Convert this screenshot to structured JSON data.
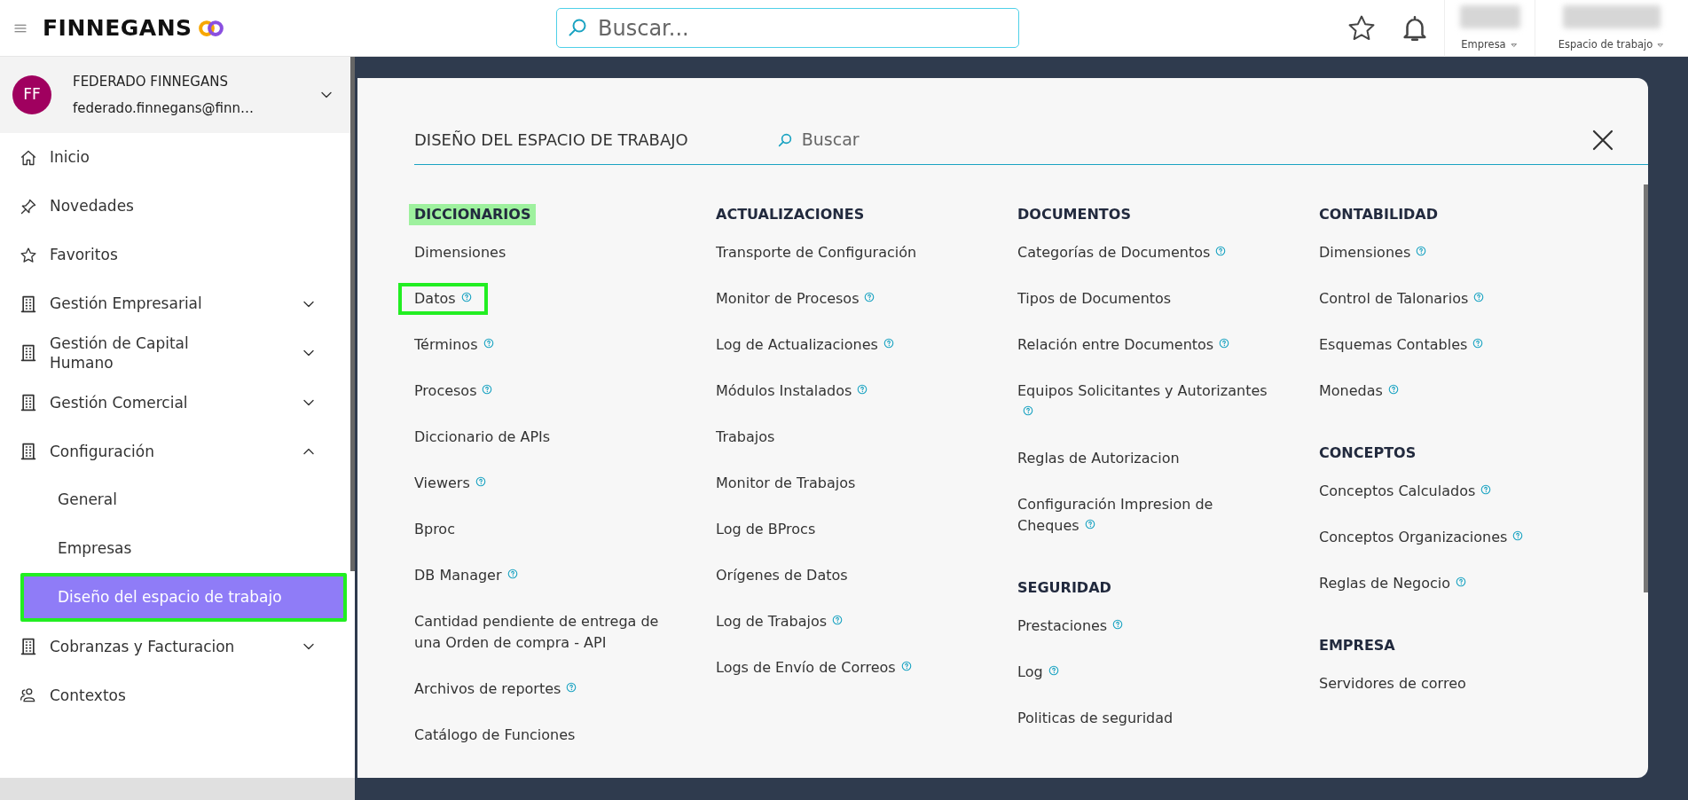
{
  "header": {
    "logo": "FINNEGANS",
    "search": {
      "placeholder": "Buscar..."
    },
    "selectors": [
      {
        "label": "Empresa"
      },
      {
        "label": "Espacio de trabajo"
      }
    ]
  },
  "user": {
    "initials": "FF",
    "name": "FEDERADO FINNEGANS",
    "email": "federado.finnegans@finn…",
    "expanded": false
  },
  "sidebar": {
    "items": [
      {
        "label": "Inicio",
        "kind": "home"
      },
      {
        "label": "Novedades",
        "kind": "pin"
      },
      {
        "label": "Favoritos",
        "kind": "star"
      },
      {
        "label": "Gestión Empresarial",
        "kind": "group",
        "expanded": false
      },
      {
        "label": "Gestión de Capital Humano",
        "kind": "group",
        "expanded": false
      },
      {
        "label": "Gestión Comercial",
        "kind": "group",
        "expanded": false
      },
      {
        "label": "Configuración",
        "kind": "group",
        "expanded": true,
        "children": [
          {
            "label": "General",
            "selected": false,
            "highlighted": false
          },
          {
            "label": "Empresas",
            "selected": false,
            "highlighted": false
          },
          {
            "label": "Diseño del espacio de trabajo",
            "selected": true,
            "highlighted": true
          }
        ]
      },
      {
        "label": "Cobranzas y Facturacion",
        "kind": "group",
        "expanded": false
      },
      {
        "label": "Contextos",
        "kind": "people"
      }
    ]
  },
  "panel": {
    "title": "DISEÑO DEL ESPACIO DE TRABAJO",
    "search": {
      "placeholder": "Buscar"
    },
    "columns": [
      {
        "sections": [
          {
            "heading": "DICCIONARIOS",
            "highlighted": true,
            "items": [
              {
                "label": "Dimensiones",
                "help": false,
                "highlighted": false
              },
              {
                "label": "Datos",
                "help": true,
                "highlighted": true
              },
              {
                "label": "Términos",
                "help": true,
                "highlighted": false
              },
              {
                "label": "Procesos",
                "help": true,
                "highlighted": false
              },
              {
                "label": "Diccionario de APIs",
                "help": false,
                "highlighted": false
              },
              {
                "label": "Viewers",
                "help": true,
                "highlighted": false
              },
              {
                "label": "Bproc",
                "help": false,
                "highlighted": false
              },
              {
                "label": "DB Manager",
                "help": true,
                "highlighted": false
              },
              {
                "label": "Cantidad pendiente de entrega de una Orden de compra - API",
                "help": false,
                "highlighted": false
              },
              {
                "label": "Archivos de reportes",
                "help": true,
                "highlighted": false
              },
              {
                "label": "Catálogo de Funciones",
                "help": false,
                "highlighted": false
              }
            ]
          }
        ]
      },
      {
        "sections": [
          {
            "heading": "ACTUALIZACIONES",
            "highlighted": false,
            "items": [
              {
                "label": "Transporte de Configuración",
                "help": false,
                "highlighted": false
              },
              {
                "label": "Monitor de Procesos",
                "help": true,
                "highlighted": false
              },
              {
                "label": "Log de Actualizaciones",
                "help": true,
                "highlighted": false
              },
              {
                "label": "Módulos Instalados",
                "help": true,
                "highlighted": false
              },
              {
                "label": "Trabajos",
                "help": false,
                "highlighted": false
              },
              {
                "label": "Monitor de Trabajos",
                "help": false,
                "highlighted": false
              },
              {
                "label": "Log de BProcs",
                "help": false,
                "highlighted": false
              },
              {
                "label": "Orígenes de Datos",
                "help": false,
                "highlighted": false
              },
              {
                "label": "Log de Trabajos",
                "help": true,
                "highlighted": false
              },
              {
                "label": "Logs de Envío de Correos",
                "help": true,
                "highlighted": false
              }
            ]
          }
        ]
      },
      {
        "sections": [
          {
            "heading": "DOCUMENTOS",
            "highlighted": false,
            "items": [
              {
                "label": "Categorías de Documentos",
                "help": true,
                "highlighted": false
              },
              {
                "label": "Tipos de Documentos",
                "help": false,
                "highlighted": false
              },
              {
                "label": "Relación entre Documentos",
                "help": true,
                "highlighted": false
              },
              {
                "label": "Equipos Solicitantes y Autorizantes",
                "help": true,
                "highlighted": false
              },
              {
                "label": "Reglas de Autorizacion",
                "help": false,
                "highlighted": false
              },
              {
                "label": "Configuración Impresion de Cheques",
                "help": true,
                "highlighted": false
              }
            ]
          },
          {
            "heading": "SEGURIDAD",
            "highlighted": false,
            "items": [
              {
                "label": "Prestaciones",
                "help": true,
                "highlighted": false
              },
              {
                "label": "Log",
                "help": true,
                "highlighted": false
              },
              {
                "label": "Politicas de seguridad",
                "help": false,
                "highlighted": false
              }
            ]
          }
        ]
      },
      {
        "sections": [
          {
            "heading": "CONTABILIDAD",
            "highlighted": false,
            "items": [
              {
                "label": "Dimensiones",
                "help": true,
                "highlighted": false
              },
              {
                "label": "Control de Talonarios",
                "help": true,
                "highlighted": false
              },
              {
                "label": "Esquemas Contables",
                "help": true,
                "highlighted": false
              },
              {
                "label": "Monedas",
                "help": true,
                "highlighted": false
              }
            ]
          },
          {
            "heading": "CONCEPTOS",
            "highlighted": false,
            "items": [
              {
                "label": "Conceptos Calculados",
                "help": true,
                "highlighted": false
              },
              {
                "label": "Conceptos Organizaciones",
                "help": true,
                "highlighted": false
              },
              {
                "label": "Reglas de Negocio",
                "help": true,
                "highlighted": false
              }
            ]
          },
          {
            "heading": "EMPRESA",
            "highlighted": false,
            "items": [
              {
                "label": "Servidores de correo",
                "help": false,
                "highlighted": false
              }
            ]
          }
        ]
      }
    ]
  }
}
